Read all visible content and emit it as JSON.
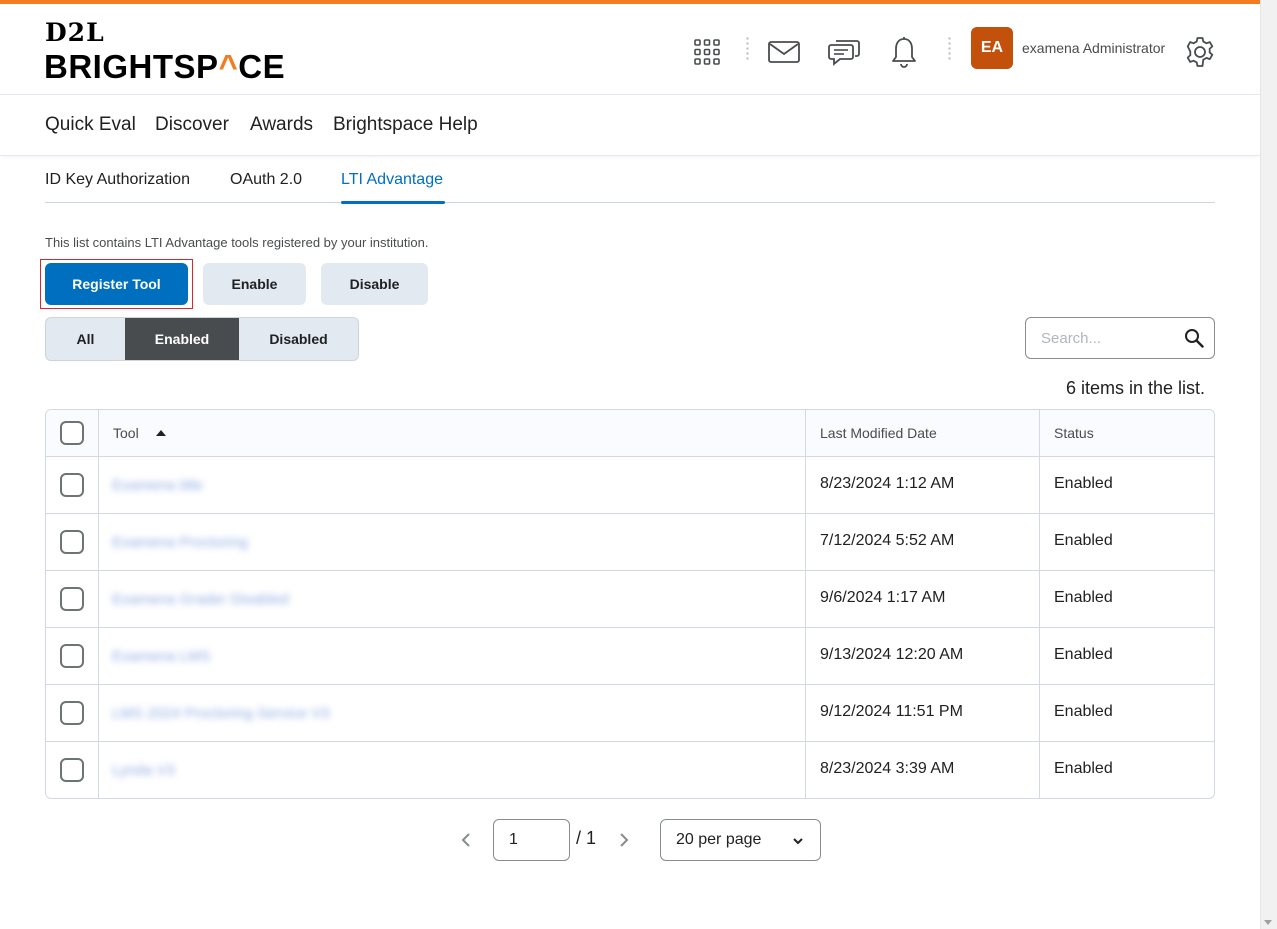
{
  "brand": {
    "top": "D2L",
    "name_left": "BRIGHTSP",
    "name_mark": "^",
    "name_right": "CE",
    "accent": "#f47b20"
  },
  "header": {
    "icons": [
      "apps-grid-icon",
      "mail-icon",
      "chat-icon",
      "bell-icon",
      "gear-icon"
    ],
    "avatar_initials": "EA",
    "user_name": "examena Administrator"
  },
  "nav": {
    "items": [
      "Quick Eval",
      "Discover",
      "Awards",
      "Brightspace Help"
    ]
  },
  "tabs": {
    "items": [
      "ID Key Authorization",
      "OAuth 2.0",
      "LTI Advantage"
    ],
    "active": "LTI Advantage"
  },
  "description": "This list contains LTI Advantage tools registered by your institution.",
  "actions": {
    "register": "Register Tool",
    "enable": "Enable",
    "disable": "Disable"
  },
  "filter": {
    "all": "All",
    "enabled": "Enabled",
    "disabled": "Disabled",
    "selected": "Enabled"
  },
  "search": {
    "placeholder": "Search..."
  },
  "count_text": "6 items in the list.",
  "table": {
    "headers": {
      "tool": "Tool",
      "modified": "Last Modified Date",
      "status": "Status"
    },
    "rows": [
      {
        "tool": "Examena title",
        "modified": "8/23/2024 1:12 AM",
        "status": "Enabled"
      },
      {
        "tool": "Examena Proctoring",
        "modified": "7/12/2024 5:52 AM",
        "status": "Enabled"
      },
      {
        "tool": "Examena Grader Disabled",
        "modified": "9/6/2024 1:17 AM",
        "status": "Enabled"
      },
      {
        "tool": "Examena LMS",
        "modified": "9/13/2024 12:20 AM",
        "status": "Enabled"
      },
      {
        "tool": "LMS 2024 Proctoring Service V3",
        "modified": "9/12/2024 11:51 PM",
        "status": "Enabled"
      },
      {
        "tool": "Lynda V3",
        "modified": "8/23/2024 3:39 AM",
        "status": "Enabled"
      }
    ]
  },
  "pagination": {
    "current": "1",
    "total_text": "/ 1",
    "per_page": "20 per page"
  }
}
